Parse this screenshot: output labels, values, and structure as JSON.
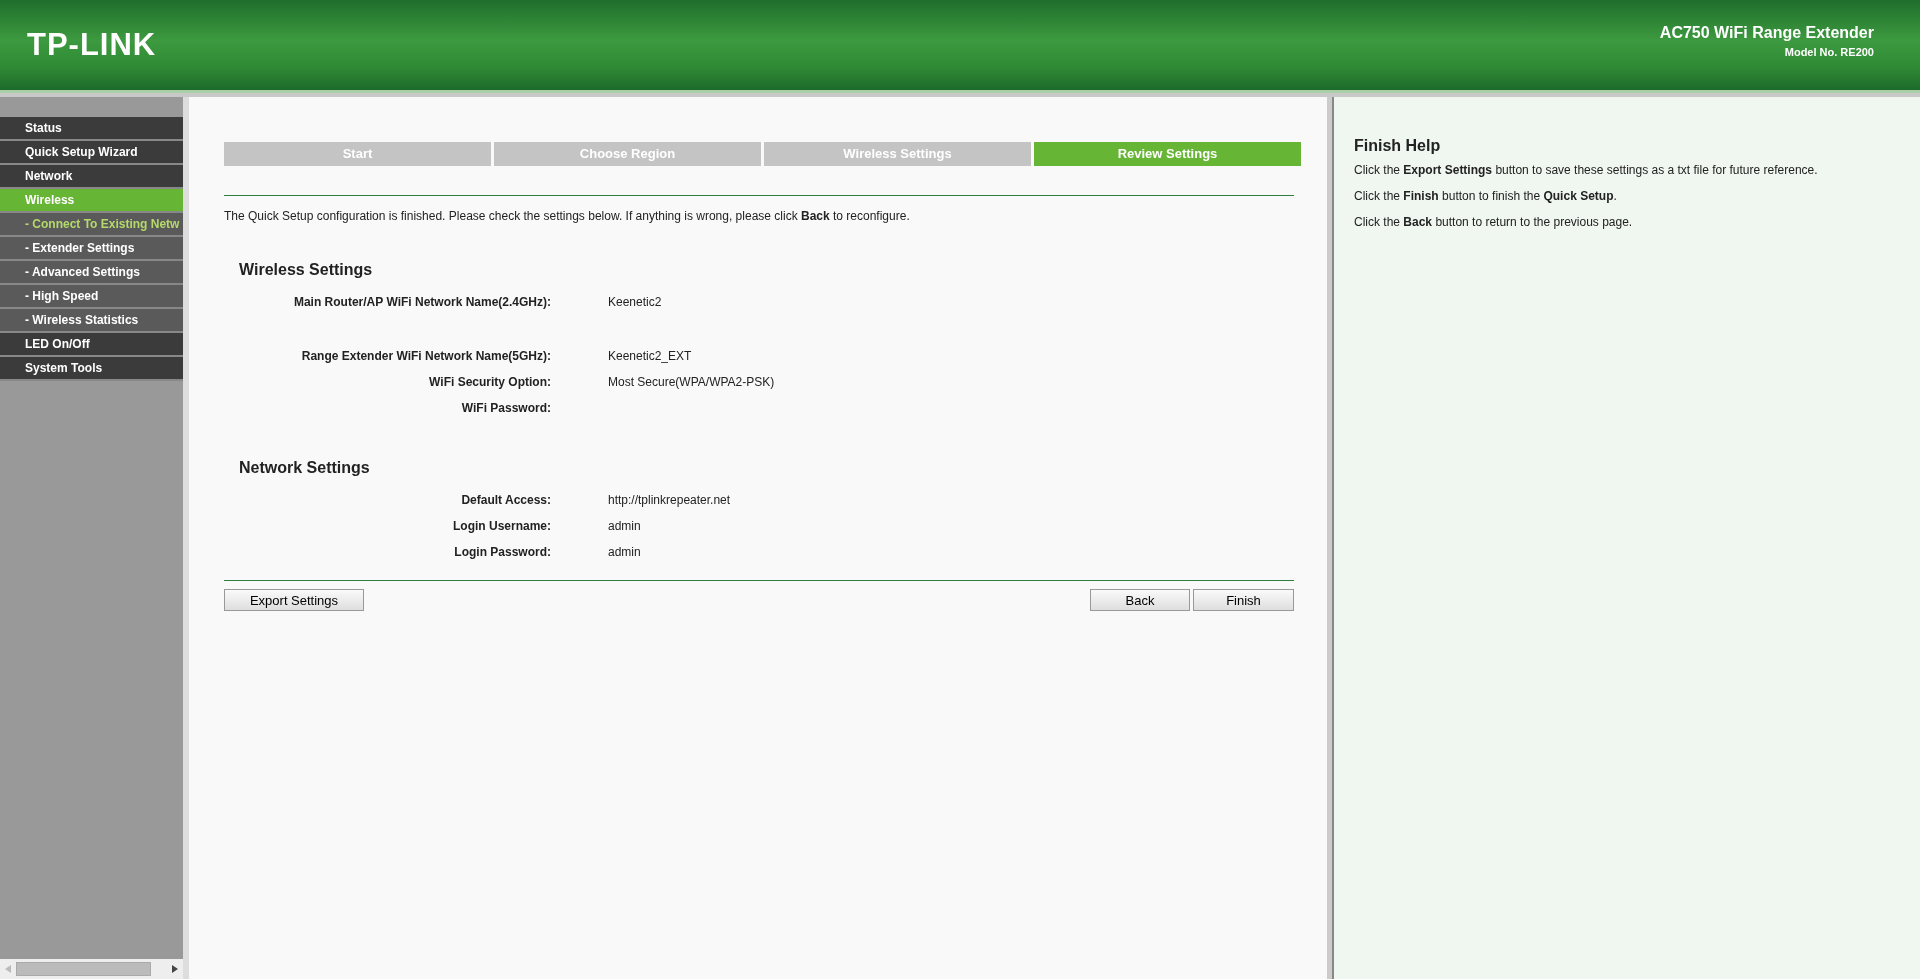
{
  "header": {
    "logo": "TP-LINK",
    "product": "AC750 WiFi Range Extender",
    "model": "Model No. RE200"
  },
  "sidebar": {
    "items": [
      {
        "label": "Status",
        "kind": "main",
        "selected": false
      },
      {
        "label": "Quick Setup Wizard",
        "kind": "main",
        "selected": false
      },
      {
        "label": "Network",
        "kind": "main",
        "selected": false
      },
      {
        "label": "Wireless",
        "kind": "main",
        "selected": true
      },
      {
        "label": "- Connect To Existing Netw",
        "kind": "sub",
        "selected": true
      },
      {
        "label": "- Extender Settings",
        "kind": "sub",
        "selected": false
      },
      {
        "label": "- Advanced Settings",
        "kind": "sub",
        "selected": false
      },
      {
        "label": "- High Speed",
        "kind": "sub",
        "selected": false
      },
      {
        "label": "- Wireless Statistics",
        "kind": "sub",
        "selected": false
      },
      {
        "label": "LED On/Off",
        "kind": "main",
        "selected": false
      },
      {
        "label": "System Tools",
        "kind": "main",
        "selected": false
      }
    ]
  },
  "steps": [
    {
      "label": "Start",
      "selected": false
    },
    {
      "label": "Choose Region",
      "selected": false
    },
    {
      "label": "Wireless Settings",
      "selected": false
    },
    {
      "label": "Review Settings",
      "selected": true
    }
  ],
  "intro": "The Quick Setup configuration is finished. Please check the settings below. If anything is wrong, please click **Back** to reconfigure.",
  "sections": [
    {
      "title": "Wireless Settings",
      "row_groups": [
        [
          {
            "label": "Main Router/AP WiFi Network Name(2.4GHz):",
            "value": "Keenetic2"
          }
        ],
        [
          {
            "label": "Range Extender WiFi Network Name(5GHz):",
            "value": "Keenetic2_EXT"
          },
          {
            "label": "WiFi Security Option:",
            "value": "Most Secure(WPA/WPA2-PSK)"
          },
          {
            "label": "WiFi Password:"
          }
        ]
      ]
    },
    {
      "title": "Network Settings",
      "row_groups": [
        [
          {
            "label": "Default Access:",
            "value": "http://tplinkrepeater.net"
          },
          {
            "label": "Login Username:",
            "value": "admin"
          },
          {
            "label": "Login Password:",
            "value": "admin"
          }
        ]
      ]
    }
  ],
  "buttons": {
    "export": "Export Settings",
    "back": "Back",
    "finish": "Finish"
  },
  "help": {
    "title": "Finish Help",
    "lines": [
      "Click the **Export Settings** button to save these settings as a txt file for future reference.",
      "Click the **Finish** button to finish the **Quick Setup**.",
      "Click the **Back** button to return to the previous page."
    ]
  }
}
